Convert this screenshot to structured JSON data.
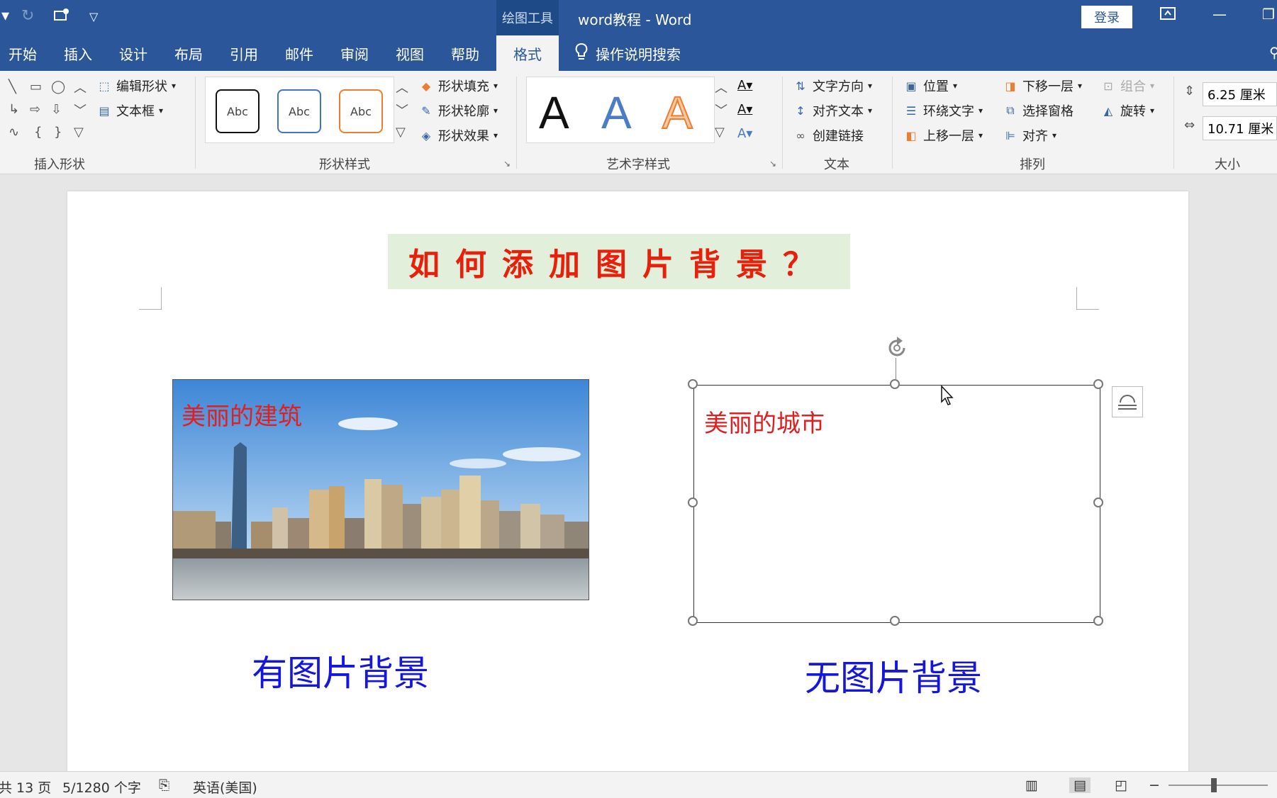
{
  "titlebar": {
    "context_tab": "绘图工具",
    "document_title": "word教程 - Word",
    "login": "登录"
  },
  "tabs": [
    "开始",
    "插入",
    "设计",
    "布局",
    "引用",
    "邮件",
    "审阅",
    "视图",
    "帮助",
    "格式"
  ],
  "tell_me": "操作说明搜索",
  "ribbon": {
    "insert_shapes": {
      "edit_shape": "编辑形状",
      "text_box": "文本框",
      "label": "插入形状"
    },
    "shape_styles": {
      "sample": "Abc",
      "fill": "形状填充",
      "outline": "形状轮廓",
      "effects": "形状效果",
      "label": "形状样式"
    },
    "wordart_styles": {
      "sample": "A",
      "label": "艺术字样式"
    },
    "text": {
      "direction": "文字方向",
      "align": "对齐文本",
      "link": "创建链接",
      "label": "文本"
    },
    "arrange": {
      "position": "位置",
      "wrap": "环绕文字",
      "bring_forward": "上移一层",
      "send_backward": "下移一层",
      "selection_pane": "选择窗格",
      "align": "对齐",
      "group": "组合",
      "rotate": "旋转",
      "label": "排列"
    },
    "size": {
      "height": "6.25 厘米",
      "width": "10.71 厘米",
      "label": "大小"
    }
  },
  "document": {
    "heading": "如何添加图片背景？",
    "photo_label": "美丽的建筑",
    "box_label": "美丽的城市",
    "caption_left": "有图片背景",
    "caption_right": "无图片背景"
  },
  "status": {
    "pages": "共 13 页",
    "words": "5/1280 个字",
    "language": "英语(美国)"
  },
  "colors": {
    "brand": "#2b579a",
    "heading_text": "#e8200b",
    "heading_bg": "#e2efda",
    "label_red": "#e02020",
    "caption_blue": "#1515e0"
  }
}
